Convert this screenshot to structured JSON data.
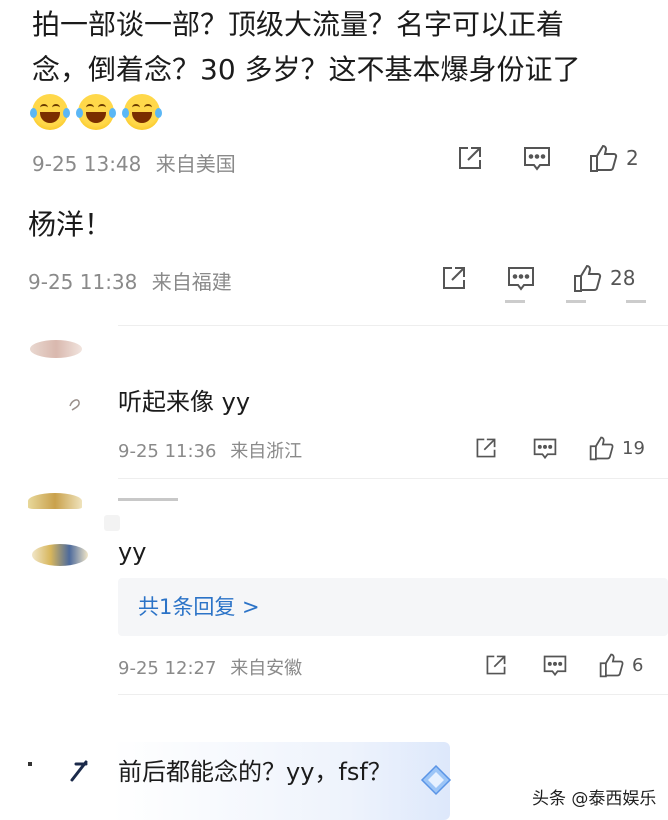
{
  "comments": [
    {
      "text_line1": "拍一部谈一部？顶级大流量？名字可以正着",
      "text_line2": "念，倒着念？30 多岁？这不基本爆身份证了",
      "emoji_count": 3,
      "time": "9-25 13:48",
      "location": "来自美国",
      "likes": "2"
    },
    {
      "text": "杨洋！",
      "time": "9-25 11:38",
      "location": "来自福建",
      "likes": "28"
    },
    {
      "text": "听起来像 yy",
      "time": "9-25 11:36",
      "location": "来自浙江",
      "likes": "19"
    },
    {
      "text": "yy",
      "reply_link": "共1条回复 >",
      "time": "9-25 12:27",
      "location": "来自安徽",
      "likes": "6"
    },
    {
      "text": "前后都能念的？yy，fsf？"
    }
  ],
  "icons": {
    "share": "share-icon",
    "comment": "comment-icon",
    "like": "thumbs-up-icon"
  },
  "watermark": "头条 @泰西娱乐",
  "colors": {
    "link": "#2b73c7",
    "meta": "#8a8a8a",
    "reply_bg": "#f5f6f8"
  }
}
